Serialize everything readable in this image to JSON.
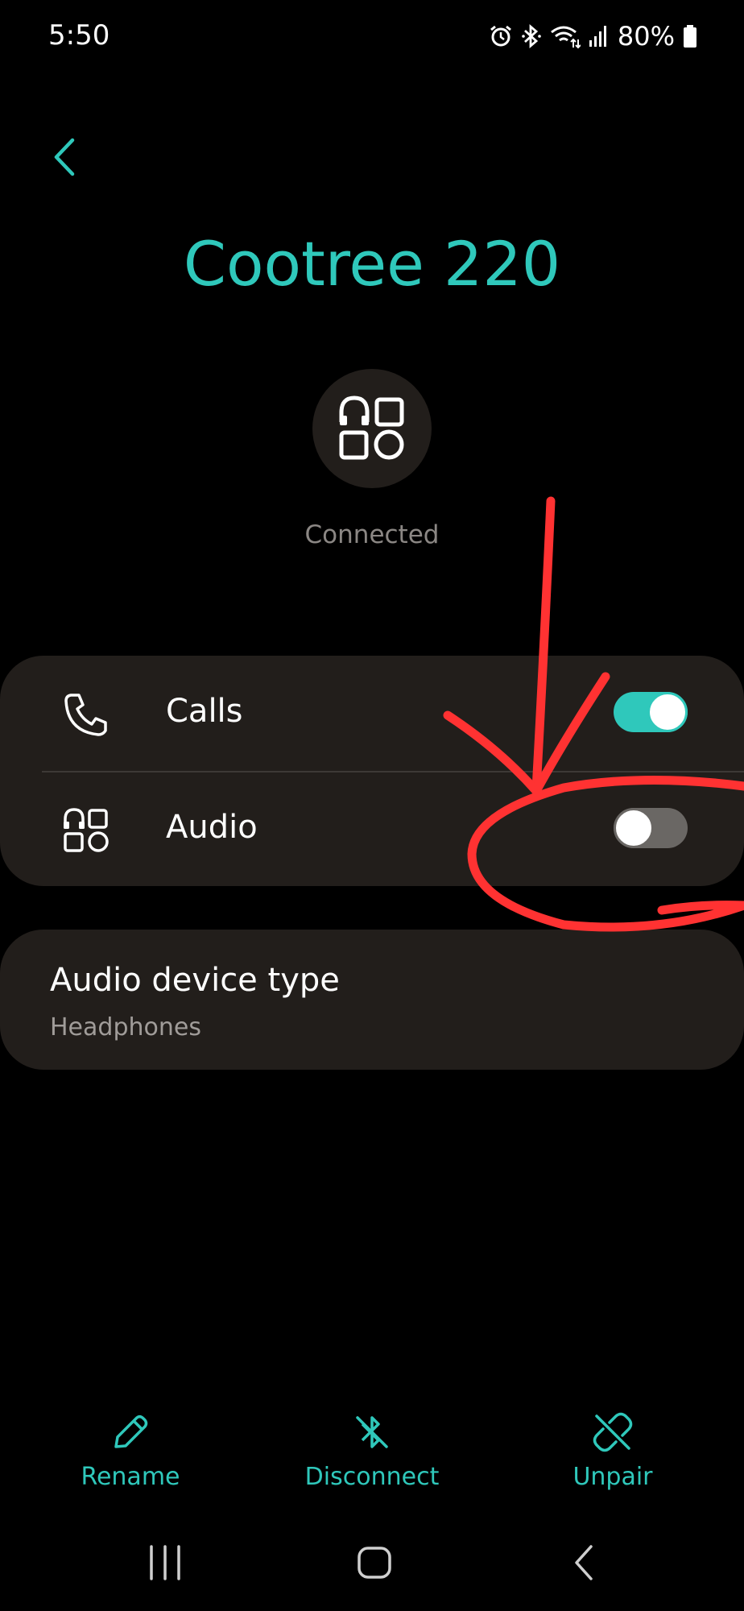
{
  "status_bar": {
    "time": "5:50",
    "battery": "80%",
    "icons": [
      "alarm-icon",
      "bluetooth-icon",
      "wifi-icon",
      "signal-icon",
      "battery-icon"
    ]
  },
  "header": {
    "back_icon": "chevron-left-icon",
    "device_name": "Cootree 220",
    "device_icon": "audio-device-icon",
    "status": "Connected"
  },
  "profiles": [
    {
      "label": "Calls",
      "icon": "phone-icon",
      "enabled": true
    },
    {
      "label": "Audio",
      "icon": "audio-device-icon",
      "enabled": false
    }
  ],
  "audio_device_type": {
    "title": "Audio device type",
    "value": "Headphones"
  },
  "actions": [
    {
      "label": "Rename",
      "icon": "pencil-icon"
    },
    {
      "label": "Disconnect",
      "icon": "bluetooth-off-icon"
    },
    {
      "label": "Unpair",
      "icon": "unlink-icon"
    }
  ],
  "nav": [
    "recents-icon",
    "home-icon",
    "back-icon"
  ],
  "colors": {
    "accent": "#2fc8bb",
    "card": "#221e1b",
    "annotation": "#ff2b2b",
    "toggle_off": "#6a6764"
  }
}
